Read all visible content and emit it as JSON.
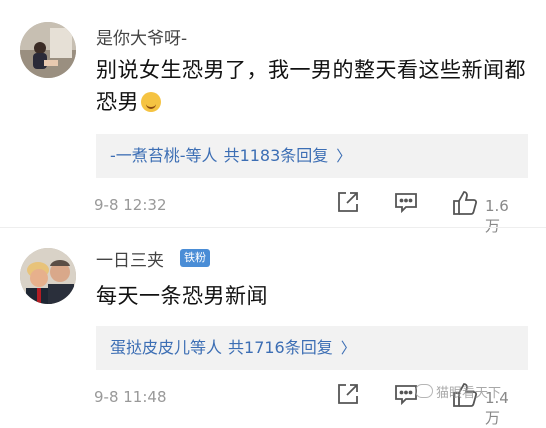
{
  "comments": [
    {
      "username": "是你大爷呀-",
      "text": "别说女生恐男了，我一男的整天看这些新闻都恐男",
      "reply_by": "-一煮苔桃-等人",
      "reply_count": "共1183条回复",
      "timestamp": "9-8 12:32",
      "likes": "1.6万"
    },
    {
      "username": "一日三夹",
      "badge": "铁粉",
      "text": "每天一条恐男新闻",
      "reply_by": "蛋挞皮皮儿等人",
      "reply_count": "共1716条回复",
      "timestamp": "9-8 11:48",
      "likes": "1.4万"
    }
  ],
  "icons": {
    "share": "share-icon",
    "comment": "comment-icon",
    "like": "thumbs-up-icon",
    "reply_chevron": "chevron-right-icon"
  },
  "colors": {
    "link_blue": "#3c6eb4",
    "badge_blue": "#4a8dd6",
    "reply_box_bg": "#f2f2f2",
    "muted": "#999999"
  },
  "watermark": "猫眼看天下"
}
